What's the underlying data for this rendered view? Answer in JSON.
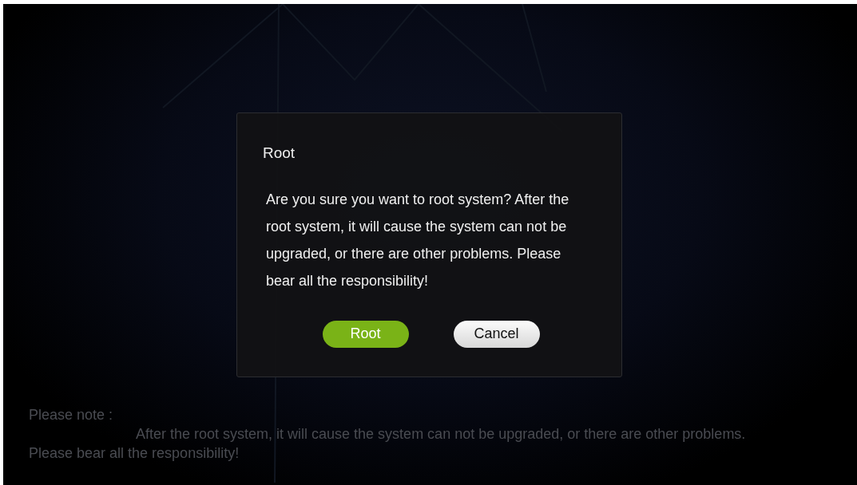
{
  "background": {
    "note_label": "Please note :",
    "note_text": "After the root system, it will cause the system can not be upgraded, or there are other problems. Please bear all the responsibility!"
  },
  "dialog": {
    "title": "Root",
    "message": "Are you sure you want to root system? After the root system, it will cause the system can not be upgraded, or there are other problems. Please bear all the responsibility!",
    "buttons": [
      {
        "label": "Root",
        "kind": "primary"
      },
      {
        "label": "Cancel",
        "kind": "secondary"
      }
    ]
  }
}
